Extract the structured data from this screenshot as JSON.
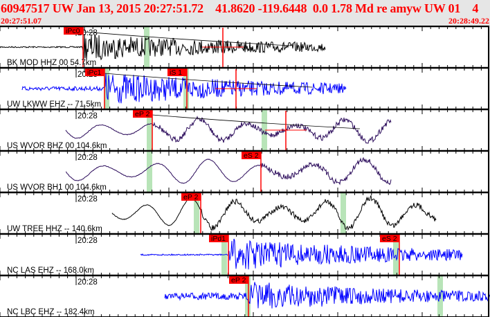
{
  "header": {
    "title": "60947517 UW Jan 13, 2015 20:27:51.72    41.8620 -119.6448  0.0 1.78 Md re amyw UW 01    4",
    "start_time": "20:27:51.07",
    "end_time": "20:28:49.22"
  },
  "colors": {
    "pick": "#ff0000",
    "window": "#b8e4b8",
    "short_period": "#0000ff",
    "broadband": "#2a0a5a",
    "high_gain": "#000000"
  },
  "channels": [
    {
      "label": "BK MOD HHZ 00 54.7km",
      "time_mark": "20:28",
      "picks": [
        "iPc0"
      ]
    },
    {
      "label": "UW LKWW EHZ -- 71.5km",
      "time_mark": "20:28",
      "picks": [
        "iPc1",
        "iS 1"
      ]
    },
    {
      "label": "US WVOR BHZ 00 104.6km",
      "time_mark": "20:28",
      "picks": [
        "eP 2"
      ]
    },
    {
      "label": "US WVOR BH1 00 104.6km",
      "time_mark": "20:28",
      "picks": [
        "eS 2"
      ]
    },
    {
      "label": "UW TREE HHZ -- 140.6km",
      "time_mark": "20:28",
      "picks": [
        "eP 2"
      ]
    },
    {
      "label": "NC LAS EHZ -- 168.0km",
      "time_mark": "20:28",
      "picks": [
        "iPd1",
        "eS 2"
      ]
    },
    {
      "label": "NC LBC EHZ -- 182.4km",
      "time_mark": "20:28",
      "picks": [
        "eP 2"
      ]
    }
  ]
}
